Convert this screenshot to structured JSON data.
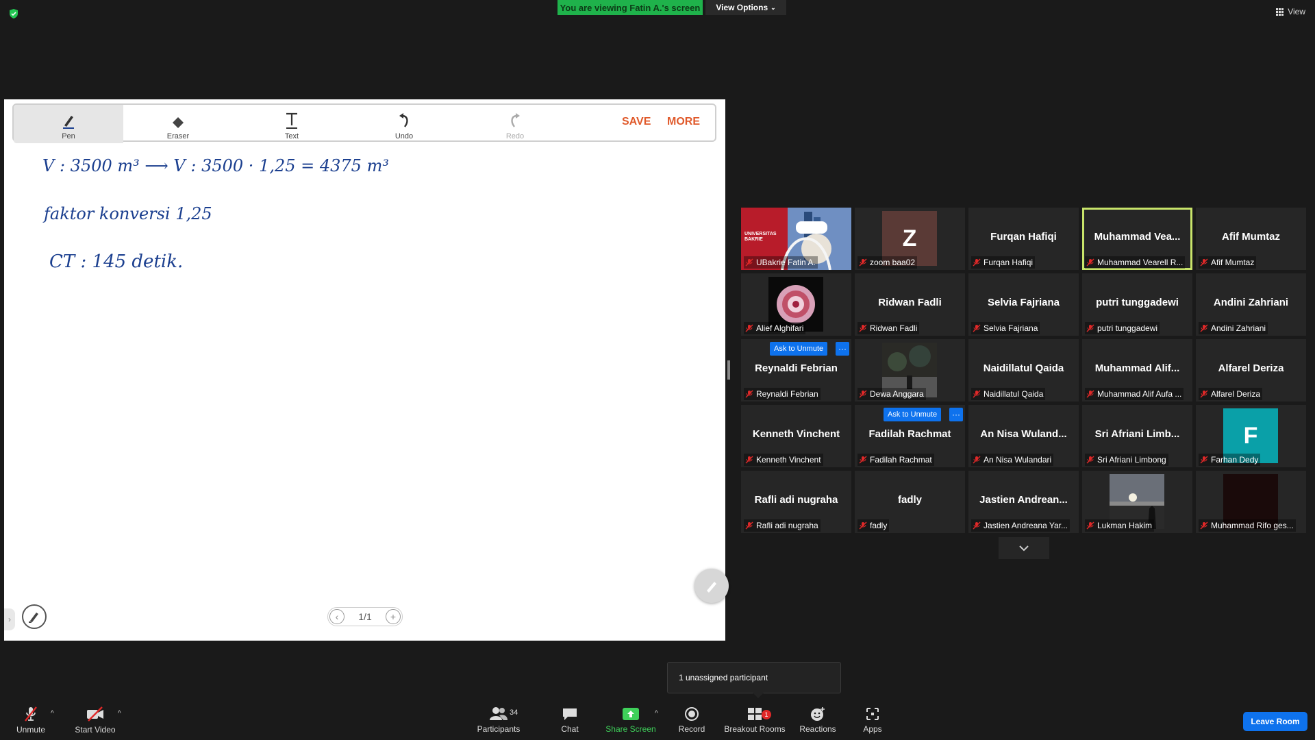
{
  "top": {
    "viewing_banner": "You are viewing Fatin A.'s screen",
    "view_options": "View Options",
    "view_label": "View"
  },
  "whiteboard": {
    "tools": {
      "pen": "Pen",
      "eraser": "Eraser",
      "text": "Text",
      "undo": "Undo",
      "redo": "Redo"
    },
    "save": "SAVE",
    "more": "MORE",
    "handwriting": [
      "V : 3500 m³  ⟶  V : 3500 · 1,25 = 4375 m³",
      "faktor konversi  1,25",
      "CT : 145 detik."
    ],
    "page_indicator": "1/1",
    "ink_color": "#1b3f8f"
  },
  "gallery": {
    "tiles": [
      {
        "caption": "UBakrie Fatin A.",
        "type": "video"
      },
      {
        "caption": "zoom baa02",
        "type": "letter",
        "letter": "Z",
        "color": "#5a3a36"
      },
      {
        "caption": "Furqan Hafiqi",
        "big_name": "Furqan Hafiqi"
      },
      {
        "caption": "Muhammad Vearell R...",
        "big_name": "Muhammad  Vea...",
        "active": true
      },
      {
        "caption": "Afif Mumtaz",
        "big_name": "Afif Mumtaz"
      },
      {
        "caption": "Alief Alghifari",
        "type": "image"
      },
      {
        "caption": "Ridwan Fadli",
        "big_name": "Ridwan Fadli"
      },
      {
        "caption": "Selvia Fajriana",
        "big_name": "Selvia Fajriana"
      },
      {
        "caption": "putri tunggadewi",
        "big_name": "putri tunggadewi"
      },
      {
        "caption": "Andini Zahriani",
        "big_name": "Andini Zahriani"
      },
      {
        "caption": "Reynaldi Febrian",
        "big_name": "Reynaldi Febrian",
        "ask": true
      },
      {
        "caption": "Dewa Anggara",
        "type": "photo"
      },
      {
        "caption": "Naidillatul Qaida",
        "big_name": "Naidillatul Qaida"
      },
      {
        "caption": "Muhammad Alif Aufa ...",
        "big_name": "Muhammad  Alif..."
      },
      {
        "caption": "Alfarel Deriza",
        "big_name": "Alfarel Deriza"
      },
      {
        "caption": "Kenneth Vinchent",
        "big_name": "Kenneth Vinchent"
      },
      {
        "caption": "Fadilah Rachmat",
        "big_name": "Fadilah Rachmat",
        "ask": true
      },
      {
        "caption": "An Nisa Wulandari",
        "big_name": "An  Nisa  Wuland..."
      },
      {
        "caption": "Sri Afriani Limbong",
        "big_name": "Sri  Afriani  Limb..."
      },
      {
        "caption": "Farhan Dedy",
        "type": "letter",
        "letter": "F",
        "color": "#0aa0a8"
      },
      {
        "caption": "Rafli adi nugraha",
        "big_name": "Rafli adi nugraha"
      },
      {
        "caption": "fadly",
        "big_name": "fadly"
      },
      {
        "caption": "Jastien Andreana Yar...",
        "big_name": "Jastien  Andrean..."
      },
      {
        "caption": "Lukman Hakim",
        "type": "sunset"
      },
      {
        "caption": "Muhammad Rifo ges...",
        "type": "dark"
      }
    ],
    "ask_to_unmute": "Ask to Unmute"
  },
  "popup": {
    "unassigned": "1 unassigned participant"
  },
  "toolbar": {
    "unmute": "Unmute",
    "start_video": "Start Video",
    "participants": "Participants",
    "participant_count": "34",
    "chat": "Chat",
    "share_screen": "Share Screen",
    "record": "Record",
    "breakout_rooms": "Breakout Rooms",
    "breakout_badge": "1",
    "reactions": "Reactions",
    "apps": "Apps",
    "leave_room": "Leave Room"
  },
  "colors": {
    "accent_blue": "#0e72ed",
    "banner_green": "#1fb24b",
    "save_orange": "#e0592a",
    "active_speaker": "#c8e46a",
    "share_green": "#3fd15a"
  }
}
